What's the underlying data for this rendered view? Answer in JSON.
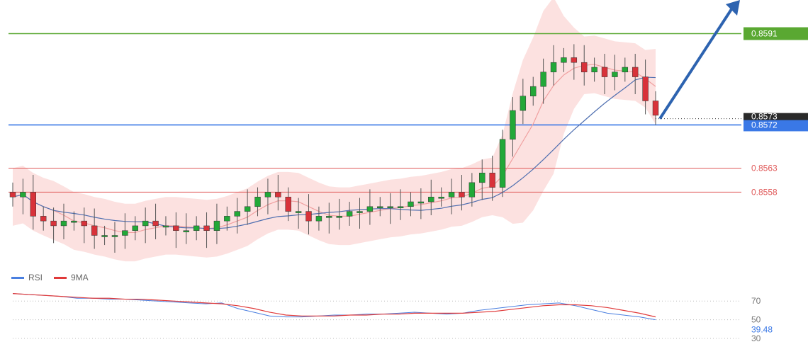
{
  "chart_data": {
    "type": "candlestick",
    "price_chart": {
      "ylim": [
        0.8542,
        0.8598
      ],
      "levels": [
        {
          "value": 0.8591,
          "label": "0.8591",
          "color": "#5aa832",
          "role": "target"
        },
        {
          "value": 0.8572,
          "label": "0.8572",
          "color": "#3a78e6",
          "role": "pivot"
        },
        {
          "value": 0.8563,
          "label": "0.8563",
          "color": "#e05a5a",
          "role": "support"
        },
        {
          "value": 0.8558,
          "label": "0.8558",
          "color": "#e05a5a",
          "role": "support"
        }
      ],
      "current_price": {
        "value": 0.8573,
        "label": "0.8573"
      },
      "closes": [
        0.8557,
        0.8558,
        0.8553,
        0.8552,
        0.8551,
        0.8552,
        0.8552,
        0.8551,
        0.8549,
        0.8549,
        0.8549,
        0.855,
        0.8551,
        0.8552,
        0.8551,
        0.8551,
        0.855,
        0.855,
        0.8551,
        0.855,
        0.8552,
        0.8553,
        0.8554,
        0.8555,
        0.8557,
        0.8558,
        0.8557,
        0.8554,
        0.8554,
        0.8552,
        0.8553,
        0.8553,
        0.8553,
        0.8554,
        0.8554,
        0.8555,
        0.8555,
        0.8555,
        0.8555,
        0.8556,
        0.8556,
        0.8557,
        0.8557,
        0.8558,
        0.8557,
        0.856,
        0.8562,
        0.8559,
        0.8569,
        0.8575,
        0.8578,
        0.858,
        0.8583,
        0.8585,
        0.8586,
        0.8585,
        0.8583,
        0.8584,
        0.8582,
        0.8583,
        0.8584,
        0.8582,
        0.8577,
        0.8574
      ],
      "rising_arrow": true
    },
    "rsi_chart": {
      "ylim": [
        30,
        80
      ],
      "levels": [
        70,
        50,
        30
      ],
      "current_value": {
        "value": 39.48,
        "label": "39.48"
      },
      "rsi": [
        78,
        77,
        76,
        75,
        73,
        73,
        72,
        72,
        71,
        70,
        69,
        68,
        67,
        68,
        62,
        58,
        54,
        53,
        53,
        54,
        55,
        55,
        56,
        56,
        57,
        58,
        57,
        56,
        57,
        60,
        62,
        64,
        66,
        67,
        68,
        65,
        61,
        57,
        55,
        53,
        50
      ],
      "ma9": [
        78,
        77,
        76,
        75,
        74,
        73,
        73,
        72,
        72,
        71,
        70,
        69,
        68,
        67,
        65,
        62,
        58,
        55,
        54,
        54,
        54,
        55,
        55,
        56,
        56,
        57,
        57,
        57,
        57,
        58,
        59,
        61,
        63,
        65,
        66,
        66,
        65,
        63,
        60,
        57,
        53
      ]
    }
  },
  "legend": {
    "rsi": {
      "label": "RSI",
      "color": "#4a7fe0"
    },
    "ma9": {
      "label": "9MA",
      "color": "#e03a3a"
    }
  },
  "colors": {
    "bull": "#22a838",
    "bear": "#d8323a",
    "bands": "#f9c9c7",
    "ma_slow": "#4f6fb0",
    "ma_fast": "#f0a0a0",
    "arrow": "#2d63b0"
  }
}
